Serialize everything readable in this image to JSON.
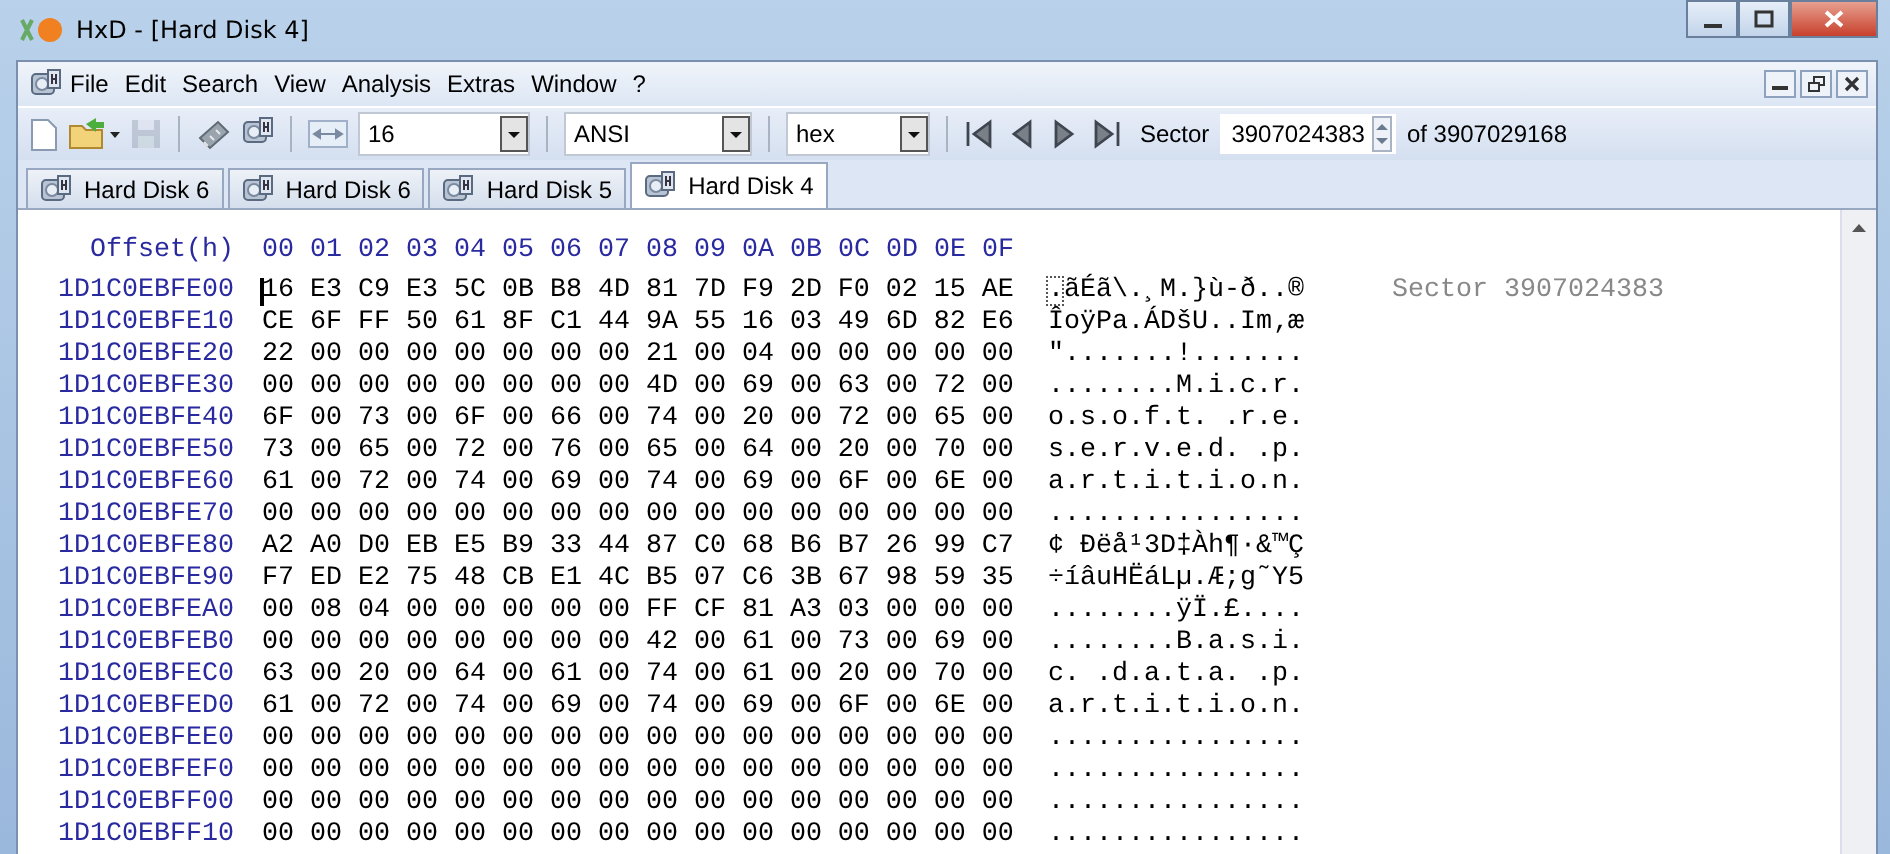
{
  "window": {
    "title": "HxD - [Hard Disk 4]"
  },
  "menu": [
    "File",
    "Edit",
    "Search",
    "View",
    "Analysis",
    "Extras",
    "Window",
    "?"
  ],
  "toolbar": {
    "buttons": [
      {
        "kind": "new",
        "disabled": false
      },
      {
        "kind": "open",
        "disabled": false
      },
      {
        "kind": "save",
        "disabled": true
      },
      {
        "kind": "ram",
        "disabled": false
      },
      {
        "kind": "disk",
        "disabled": false
      }
    ],
    "bytes_per_row": "16",
    "charset": "ANSI",
    "offset_base": "hex",
    "nav": [
      {
        "kind": "first"
      },
      {
        "kind": "prev"
      },
      {
        "kind": "next"
      },
      {
        "kind": "last"
      }
    ],
    "sector_label": "Sector",
    "sector_value": "3907024383",
    "sector_total": "of 3907029168"
  },
  "tabs": [
    {
      "label": "Hard Disk 6",
      "selected": false
    },
    {
      "label": "Hard Disk 6",
      "selected": false
    },
    {
      "label": "Hard Disk 5",
      "selected": false
    },
    {
      "label": "Hard Disk 4",
      "selected": true
    }
  ],
  "editor": {
    "offset_header": "Offset(h)",
    "columns": [
      "00",
      "01",
      "02",
      "03",
      "04",
      "05",
      "06",
      "07",
      "08",
      "09",
      "0A",
      "0B",
      "0C",
      "0D",
      "0E",
      "0F"
    ],
    "sector_note": "Sector 3907024383",
    "rows": [
      {
        "offset": "1D1C0EBFE00",
        "hex": "16 E3 C9 E3 5C 0B B8 4D 81 7D F9 2D F0 02 15 AE",
        "text": ".ãÉã\\.¸M.}ù-ð..®",
        "cursor": true
      },
      {
        "offset": "1D1C0EBFE10",
        "hex": "CE 6F FF 50 61 8F C1 44 9A 55 16 03 49 6D 82 E6",
        "text": "ÎoÿPa.ÁDšU..Im‚æ",
        "cursor": false
      },
      {
        "offset": "1D1C0EBFE20",
        "hex": "22 00 00 00 00 00 00 00 21 00 04 00 00 00 00 00",
        "text": "\".......!.......",
        "cursor": false
      },
      {
        "offset": "1D1C0EBFE30",
        "hex": "00 00 00 00 00 00 00 00 4D 00 69 00 63 00 72 00",
        "text": "........M.i.c.r.",
        "cursor": false
      },
      {
        "offset": "1D1C0EBFE40",
        "hex": "6F 00 73 00 6F 00 66 00 74 00 20 00 72 00 65 00",
        "text": "o.s.o.f.t. .r.e.",
        "cursor": false
      },
      {
        "offset": "1D1C0EBFE50",
        "hex": "73 00 65 00 72 00 76 00 65 00 64 00 20 00 70 00",
        "text": "s.e.r.v.e.d. .p.",
        "cursor": false
      },
      {
        "offset": "1D1C0EBFE60",
        "hex": "61 00 72 00 74 00 69 00 74 00 69 00 6F 00 6E 00",
        "text": "a.r.t.i.t.i.o.n.",
        "cursor": false
      },
      {
        "offset": "1D1C0EBFE70",
        "hex": "00 00 00 00 00 00 00 00 00 00 00 00 00 00 00 00",
        "text": "................",
        "cursor": false
      },
      {
        "offset": "1D1C0EBFE80",
        "hex": "A2 A0 D0 EB E5 B9 33 44 87 C0 68 B6 B7 26 99 C7",
        "text": "¢ Ðëå¹3D‡Àh¶·&™Ç",
        "cursor": false
      },
      {
        "offset": "1D1C0EBFE90",
        "hex": "F7 ED E2 75 48 CB E1 4C B5 07 C6 3B 67 98 59 35",
        "text": "÷íâuHËáLµ.Æ;g˜Y5",
        "cursor": false
      },
      {
        "offset": "1D1C0EBFEA0",
        "hex": "00 08 04 00 00 00 00 00 FF CF 81 A3 03 00 00 00",
        "text": "........ÿÏ.£....",
        "cursor": false
      },
      {
        "offset": "1D1C0EBFEB0",
        "hex": "00 00 00 00 00 00 00 00 42 00 61 00 73 00 69 00",
        "text": "........B.a.s.i.",
        "cursor": false
      },
      {
        "offset": "1D1C0EBFEC0",
        "hex": "63 00 20 00 64 00 61 00 74 00 61 00 20 00 70 00",
        "text": "c. .d.a.t.a. .p.",
        "cursor": false
      },
      {
        "offset": "1D1C0EBFED0",
        "hex": "61 00 72 00 74 00 69 00 74 00 69 00 6F 00 6E 00",
        "text": "a.r.t.i.t.i.o.n.",
        "cursor": false
      },
      {
        "offset": "1D1C0EBFEE0",
        "hex": "00 00 00 00 00 00 00 00 00 00 00 00 00 00 00 00",
        "text": "................",
        "cursor": false
      },
      {
        "offset": "1D1C0EBFEF0",
        "hex": "00 00 00 00 00 00 00 00 00 00 00 00 00 00 00 00",
        "text": "................",
        "cursor": false
      },
      {
        "offset": "1D1C0EBFF00",
        "hex": "00 00 00 00 00 00 00 00 00 00 00 00 00 00 00 00",
        "text": "................",
        "cursor": false
      },
      {
        "offset": "1D1C0EBFF10",
        "hex": "00 00 00 00 00 00 00 00 00 00 00 00 00 00 00 00",
        "text": "................",
        "cursor": false
      }
    ]
  }
}
